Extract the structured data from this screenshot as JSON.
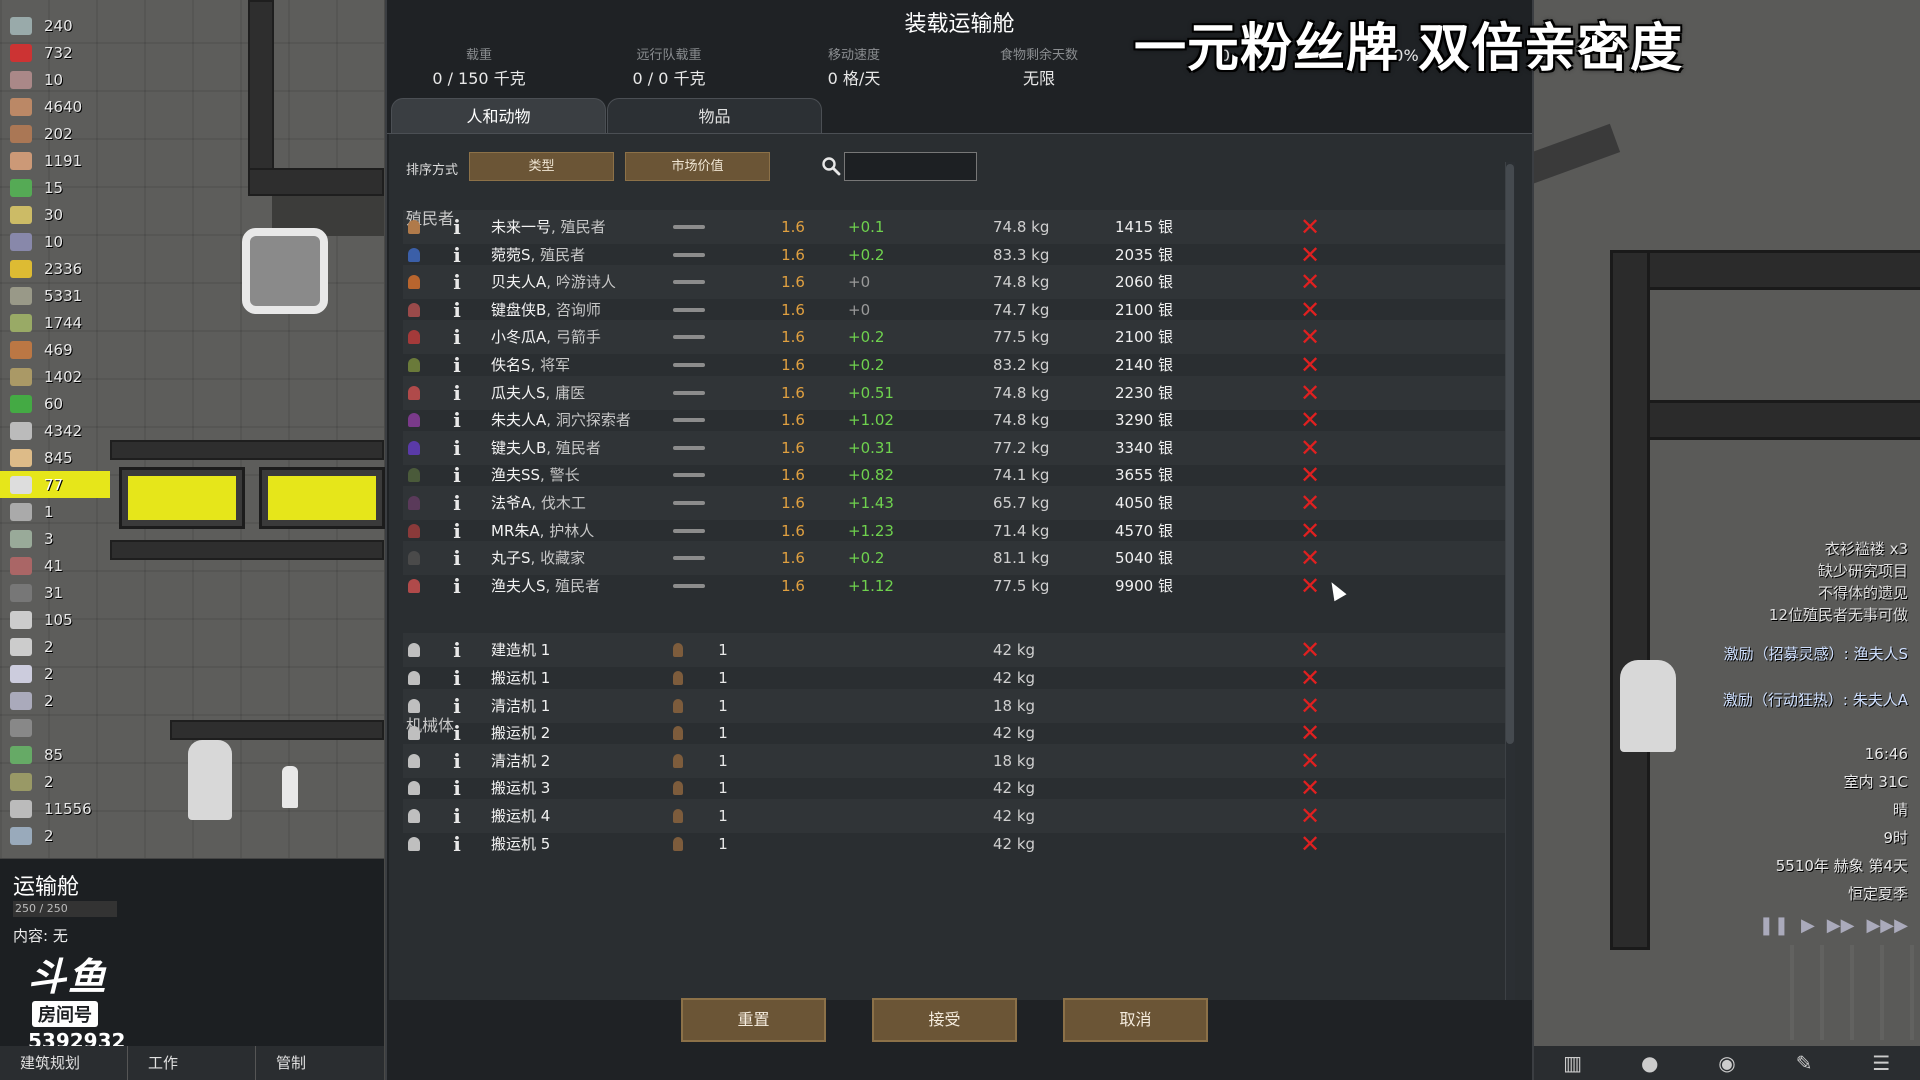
{
  "colony_resources": [
    {
      "icon": "steel-icon",
      "value": "240"
    },
    {
      "icon": "meat-icon",
      "value": "732"
    },
    {
      "icon": "component-icon",
      "value": "10"
    },
    {
      "icon": "wood-icon",
      "value": "4640"
    },
    {
      "icon": "leather-icon",
      "value": "202"
    },
    {
      "icon": "cloth-icon",
      "value": "1191"
    },
    {
      "icon": "herb-icon",
      "value": "15"
    },
    {
      "icon": "hay-icon",
      "value": "30"
    },
    {
      "icon": "plasteel-icon",
      "value": "10"
    },
    {
      "icon": "gold-icon",
      "value": "2336"
    },
    {
      "icon": "stone-icon",
      "value": "5331"
    },
    {
      "icon": "rice-icon",
      "value": "1744"
    },
    {
      "icon": "berry-icon",
      "value": "469"
    },
    {
      "icon": "kibble-icon",
      "value": "1402"
    },
    {
      "icon": "medicine-icon",
      "value": "60"
    },
    {
      "icon": "silver-icon",
      "value": "4342"
    },
    {
      "icon": "packaged-meal-icon",
      "value": "845"
    },
    {
      "icon": "pill-icon",
      "value": "77",
      "highlight": true
    },
    {
      "icon": "ammo-icon",
      "value": "1"
    },
    {
      "icon": "rifle-icon",
      "value": "3"
    },
    {
      "icon": "bar-icon",
      "value": "41"
    },
    {
      "icon": "chunk-icon",
      "value": "31"
    },
    {
      "icon": "skull-icon",
      "value": "105"
    },
    {
      "icon": "helmet-icon",
      "value": "2"
    },
    {
      "icon": "shirt-icon",
      "value": "2"
    },
    {
      "icon": "armor-icon",
      "value": "2"
    },
    {
      "icon": "knife-icon",
      "value": ""
    },
    {
      "icon": "plant-icon",
      "value": "85"
    },
    {
      "icon": "sword-icon",
      "value": "2"
    },
    {
      "icon": "steel-bar-icon",
      "value": "11556"
    },
    {
      "icon": "tool-icon",
      "value": "2"
    }
  ],
  "pod_info": {
    "title": "运输舱",
    "capacity": "250 / 250",
    "contents": "内容: 无"
  },
  "watermark": {
    "logo": "斗鱼",
    "tag": "房间号",
    "room": "5392932"
  },
  "bottom_bar": [
    "建筑规划",
    "工作",
    "管制"
  ],
  "overlay_text": "一元粉丝牌 双倍亲密度",
  "dialog": {
    "title": "装载运输舱",
    "stats": [
      {
        "label": "载重",
        "value": "0 / 150 千克"
      },
      {
        "label": "远行队载重",
        "value": "0 / 0 千克"
      },
      {
        "label": "移动速度",
        "value": "0 格/天"
      },
      {
        "label": "食物剩余天数",
        "value": "无限"
      },
      {
        "label": "",
        "value": "0"
      },
      {
        "label": "",
        "value": "0%"
      }
    ],
    "tabs": [
      "人和动物",
      "物品"
    ],
    "sort_label": "排序方式",
    "sort_buttons": [
      "类型",
      "市场价值"
    ],
    "search_placeholder": "",
    "sections": {
      "colonists": "殖民者",
      "mechs": "机械体"
    },
    "colonists": [
      {
        "name": "未来一号",
        "role": "殖民者",
        "speed": "1.6",
        "mood": "+0.1",
        "mass": "74.8 kg",
        "value": "1415 银",
        "color": "#b07a4a"
      },
      {
        "name": "菀菀S",
        "role": "殖民者",
        "speed": "1.6",
        "mood": "+0.2",
        "mass": "83.3 kg",
        "value": "2035 银",
        "color": "#3b5fa8"
      },
      {
        "name": "贝夫人A",
        "role": "吟游诗人",
        "speed": "1.6",
        "mood": "+0",
        "mass": "74.8 kg",
        "value": "2060 银",
        "color": "#b8652e"
      },
      {
        "name": "键盘侠B",
        "role": "咨询师",
        "speed": "1.6",
        "mood": "+0",
        "mass": "74.7 kg",
        "value": "2100 银",
        "color": "#9a4a4a"
      },
      {
        "name": "小冬瓜A",
        "role": "弓箭手",
        "speed": "1.6",
        "mood": "+0.2",
        "mass": "77.5 kg",
        "value": "2100 银",
        "color": "#a43a3a"
      },
      {
        "name": "佚名S",
        "role": "将军",
        "speed": "1.6",
        "mood": "+0.2",
        "mass": "83.2 kg",
        "value": "2140 银",
        "color": "#6a7a3a"
      },
      {
        "name": "瓜夫人S",
        "role": "庸医",
        "speed": "1.6",
        "mood": "+0.51",
        "mass": "74.8 kg",
        "value": "2230 银",
        "color": "#b04a4a"
      },
      {
        "name": "朱夫人A",
        "role": "洞穴探索者",
        "speed": "1.6",
        "mood": "+1.02",
        "mass": "74.8 kg",
        "value": "3290 银",
        "color": "#7a3a8a"
      },
      {
        "name": "键夫人B",
        "role": "殖民者",
        "speed": "1.6",
        "mood": "+0.31",
        "mass": "77.2 kg",
        "value": "3340 银",
        "color": "#5a3aa8"
      },
      {
        "name": "渔夫SS",
        "role": "警长",
        "speed": "1.6",
        "mood": "+0.82",
        "mass": "74.1 kg",
        "value": "3655 银",
        "color": "#4a5a3a"
      },
      {
        "name": "法爷A",
        "role": "伐木工",
        "speed": "1.6",
        "mood": "+1.43",
        "mass": "65.7 kg",
        "value": "4050 银",
        "color": "#5a3a5a"
      },
      {
        "name": "MR朱A",
        "role": "护林人",
        "speed": "1.6",
        "mood": "+1.23",
        "mass": "71.4 kg",
        "value": "4570 银",
        "color": "#8a3a3a"
      },
      {
        "name": "丸子S",
        "role": "收藏家",
        "speed": "1.6",
        "mood": "+0.2",
        "mass": "81.1 kg",
        "value": "5040 银",
        "color": "#4a4a4a"
      },
      {
        "name": "渔夫人S",
        "role": "殖民者",
        "speed": "1.6",
        "mood": "+1.12",
        "mass": "77.5 kg",
        "value": "9900 银",
        "color": "#b04a4a"
      }
    ],
    "mechs": [
      {
        "name": "建造机 1",
        "count": "1",
        "mass": "42 kg"
      },
      {
        "name": "搬运机 1",
        "count": "1",
        "mass": "42 kg"
      },
      {
        "name": "清洁机 1",
        "count": "1",
        "mass": "18 kg"
      },
      {
        "name": "搬运机 2",
        "count": "1",
        "mass": "42 kg"
      },
      {
        "name": "清洁机 2",
        "count": "1",
        "mass": "18 kg"
      },
      {
        "name": "搬运机 3",
        "count": "1",
        "mass": "42 kg"
      },
      {
        "name": "搬运机 4",
        "count": "1",
        "mass": "42 kg"
      },
      {
        "name": "搬运机 5",
        "count": "1",
        "mass": "42 kg"
      }
    ],
    "buttons": {
      "reset": "重置",
      "accept": "接受",
      "cancel": "取消"
    }
  },
  "right_notes": [
    "衣衫褴褛 x3",
    "缺少研究项目",
    "不得体的遗见",
    "12位殖民者无事可做"
  ],
  "right_buffs": [
    "激励（招募灵感）: 渔夫人S",
    "激励（行动狂热）: 朱夫人A"
  ],
  "clock": [
    "16:46",
    "室内 31C",
    "晴",
    "9时",
    "5510年 赫象 第4天",
    "恒定夏季"
  ],
  "speed_controls": [
    "❚❚",
    "▶",
    "▶▶",
    "▶▶▶"
  ]
}
